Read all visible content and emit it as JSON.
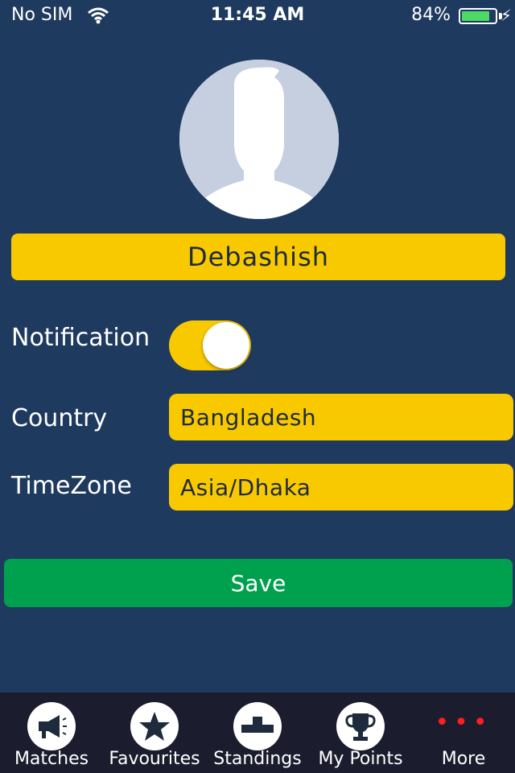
{
  "status_bar": {
    "carrier": "No SIM",
    "time": "11:45 AM",
    "battery_percent": "84%",
    "battery_level": 0.84,
    "battery_color": "#4cd964"
  },
  "profile": {
    "name": "Debashish",
    "avatar_icon": "person-silhouette-icon"
  },
  "settings": {
    "notification_label": "Notification",
    "notification_on": true,
    "country_label": "Country",
    "country_value": "Bangladesh",
    "timezone_label": "TimeZone",
    "timezone_value": "Asia/Dhaka"
  },
  "actions": {
    "save_label": "Save"
  },
  "tab_bar": {
    "tabs": [
      {
        "label": "Matches",
        "icon": "megaphone-icon"
      },
      {
        "label": "Favourites",
        "icon": "star-icon"
      },
      {
        "label": "Standings",
        "icon": "podium-icon"
      },
      {
        "label": "My Points",
        "icon": "trophy-icon"
      },
      {
        "label": "More",
        "icon": "more-dots-icon"
      }
    ]
  },
  "colors": {
    "background": "#1e3a5f",
    "accent_yellow": "#f9c900",
    "save_green": "#00a14e",
    "tab_bar": "#1b1d2e",
    "more_red": "#ff1f1f"
  }
}
